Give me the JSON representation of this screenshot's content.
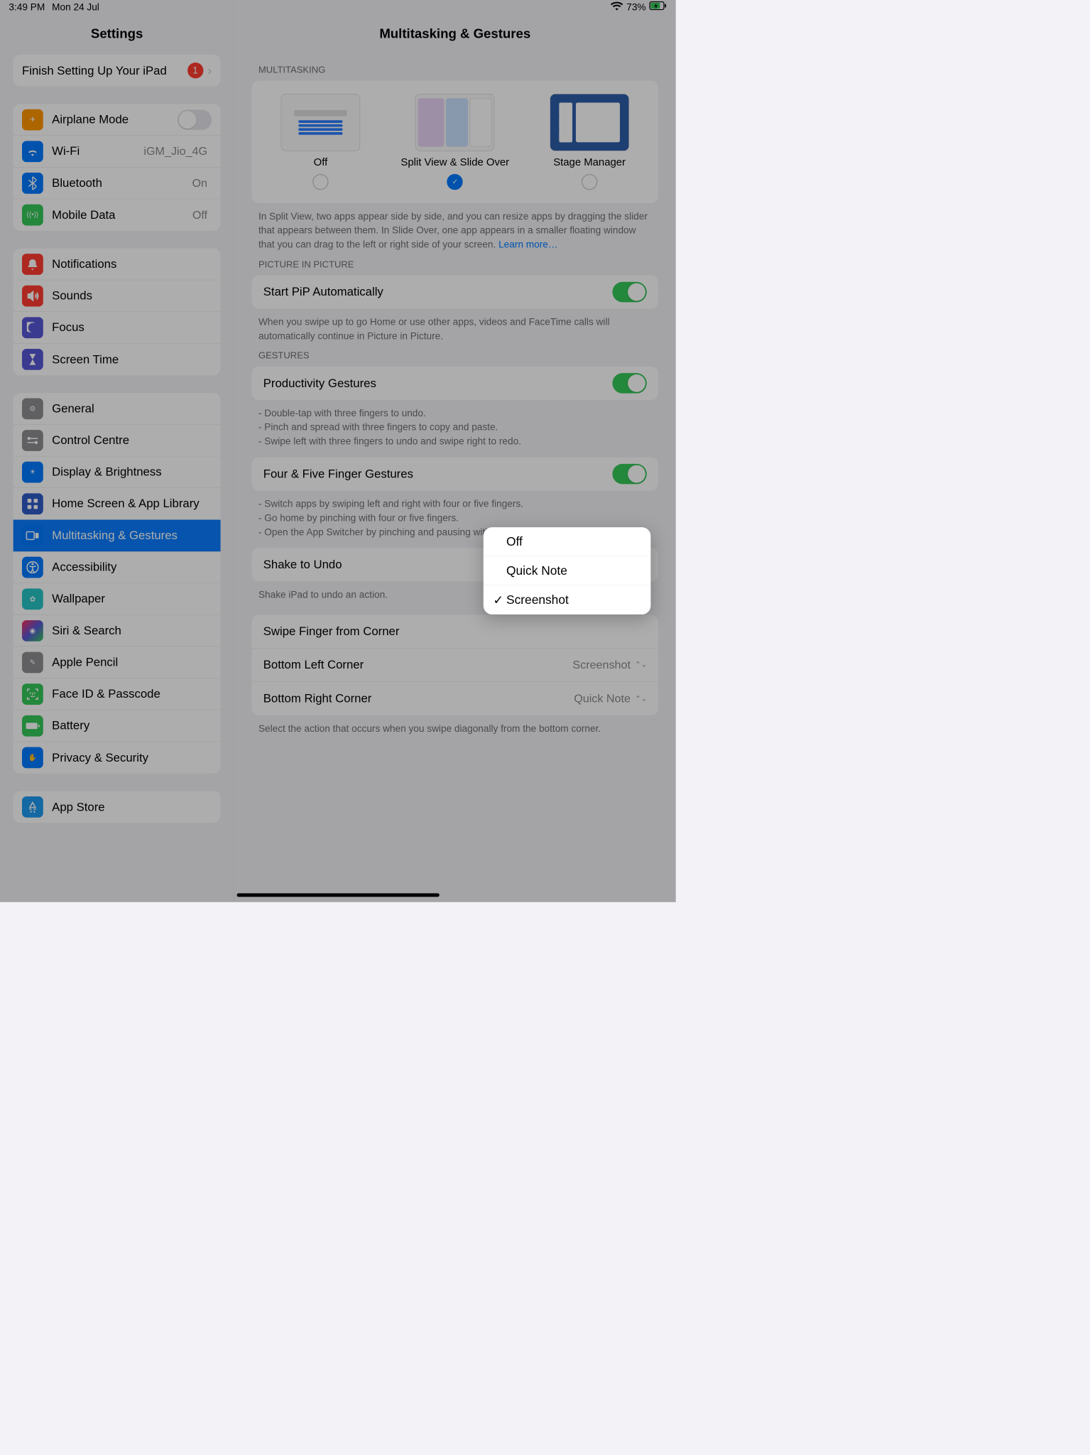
{
  "status": {
    "time": "3:49 PM",
    "date": "Mon 24 Jul",
    "battery_pct": "73%"
  },
  "sidebar": {
    "title": "Settings",
    "finish": {
      "label": "Finish Setting Up Your iPad",
      "badge": "1"
    },
    "net": {
      "airplane": "Airplane Mode",
      "wifi": "Wi-Fi",
      "wifi_value": "iGM_Jio_4G",
      "bluetooth": "Bluetooth",
      "bluetooth_value": "On",
      "mobile": "Mobile Data",
      "mobile_value": "Off"
    },
    "attn": {
      "notifications": "Notifications",
      "sounds": "Sounds",
      "focus": "Focus",
      "screentime": "Screen Time"
    },
    "gen": {
      "general": "General",
      "control": "Control Centre",
      "display": "Display & Brightness",
      "home": "Home Screen & App Library",
      "multi": "Multitasking & Gestures",
      "accessibility": "Accessibility",
      "wallpaper": "Wallpaper",
      "siri": "Siri & Search",
      "pencil": "Apple Pencil",
      "faceid": "Face ID & Passcode",
      "battery": "Battery",
      "privacy": "Privacy & Security"
    },
    "store": {
      "appstore": "App Store"
    }
  },
  "detail": {
    "title": "Multitasking & Gestures",
    "multi": {
      "header": "MULTITASKING",
      "off": "Off",
      "split": "Split View & Slide Over",
      "stage": "Stage Manager",
      "footer_a": "In Split View, two apps appear side by side, and you can resize apps by dragging the slider that appears between them. In Slide Over, one app appears in a smaller floating window that you can drag to the left or right side of your screen. ",
      "learn_more": "Learn more…"
    },
    "pip": {
      "header": "PICTURE IN PICTURE",
      "label": "Start PiP Automatically",
      "footer": "When you swipe up to go Home or use other apps, videos and FaceTime calls will automatically continue in Picture in Picture."
    },
    "gestures": {
      "header": "GESTURES",
      "productivity": "Productivity Gestures",
      "productivity_footer": "- Double-tap with three fingers to undo.\n- Pinch and spread with three fingers to copy and paste.\n- Swipe left with three fingers to undo and swipe right to redo.",
      "fourfive": "Four & Five Finger Gestures",
      "fourfive_footer": "- Switch apps by swiping left and right with four or five fingers.\n- Go home by pinching with four or five fingers.\n- Open the App Switcher by pinching and pausing with four or five fingers.",
      "shake": "Shake to Undo",
      "shake_footer": "Shake iPad to undo an action."
    },
    "corner": {
      "header": "Swipe Finger from Corner",
      "bl": "Bottom Left Corner",
      "bl_value": "Screenshot",
      "br": "Bottom Right Corner",
      "br_value": "Quick Note",
      "footer": "Select the action that occurs when you swipe diagonally from the bottom corner."
    }
  },
  "popup": {
    "off": "Off",
    "quicknote": "Quick Note",
    "screenshot": "Screenshot"
  },
  "colors": {
    "bg_airplane": "#ff9500",
    "bg_wifi": "#007aff",
    "bg_bt": "#007aff",
    "bg_mobile": "#34c759",
    "bg_notif": "#ff3b30",
    "bg_sounds": "#ff3b30",
    "bg_focus": "#5856d6",
    "bg_screentime": "#5856d6",
    "bg_general": "#8e8e93",
    "bg_control": "#8e8e93",
    "bg_display": "#007aff",
    "bg_home": "#2f5cc7",
    "bg_multi": "#007aff",
    "bg_access": "#007aff",
    "bg_wallpaper": "#29c4c4",
    "bg_siri": "#000000",
    "bg_pencil": "#8e8e93",
    "bg_faceid": "#34c759",
    "bg_battery": "#34c759",
    "bg_privacy": "#007aff",
    "bg_appstore": "#1e9af0"
  }
}
